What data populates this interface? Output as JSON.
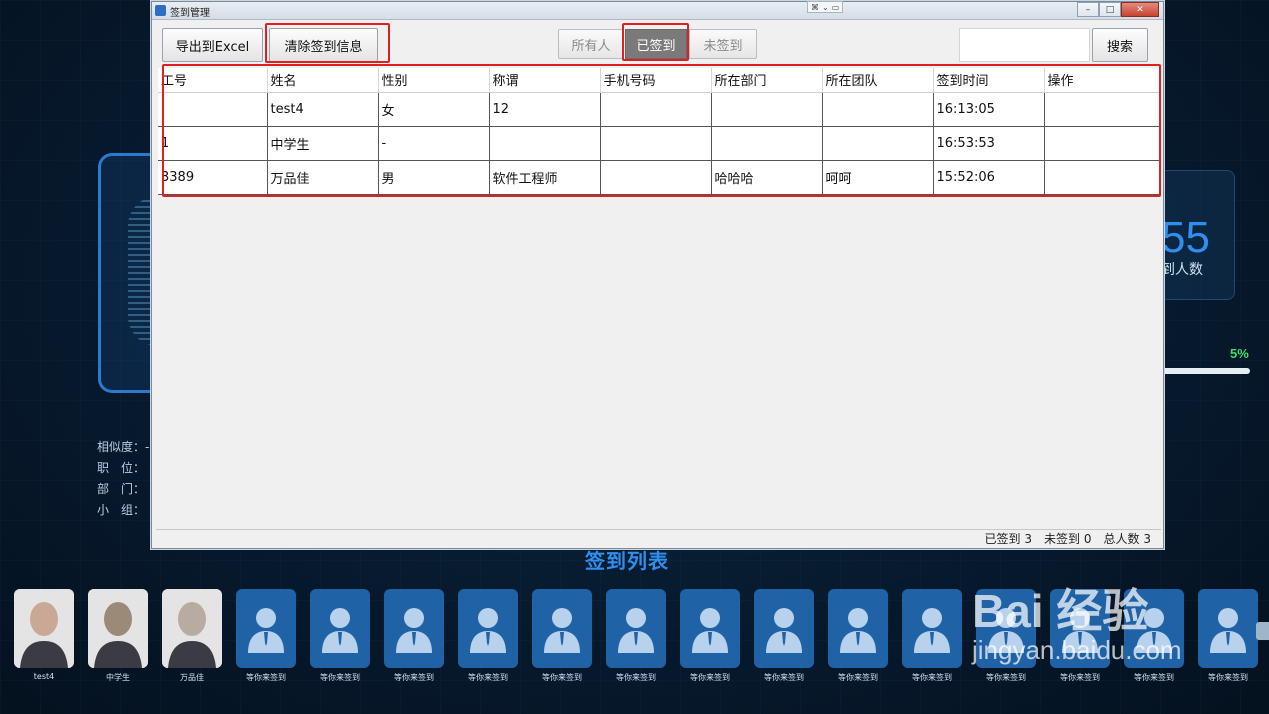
{
  "background": {
    "stat": {
      "value": "55",
      "label": "到人数"
    },
    "progress": {
      "percent_label": "5%",
      "fraction": 0.05
    },
    "info_fields": [
      {
        "label": "相似度：",
        "value": "-"
      },
      {
        "label": "职　位：",
        "value": ""
      },
      {
        "label": "部　门：",
        "value": ""
      },
      {
        "label": "小　组：",
        "value": ""
      }
    ],
    "list_title": "签到列表",
    "avatars": [
      {
        "caption": "test4",
        "type": "photo"
      },
      {
        "caption": "中学生",
        "type": "photo"
      },
      {
        "caption": "万品佳",
        "type": "photo"
      },
      {
        "caption": "等你来签到",
        "type": "placeholder"
      },
      {
        "caption": "等你来签到",
        "type": "placeholder"
      },
      {
        "caption": "等你来签到",
        "type": "placeholder"
      },
      {
        "caption": "等你来签到",
        "type": "placeholder"
      },
      {
        "caption": "等你来签到",
        "type": "placeholder"
      },
      {
        "caption": "等你来签到",
        "type": "placeholder"
      },
      {
        "caption": "等你来签到",
        "type": "placeholder"
      },
      {
        "caption": "等你来签到",
        "type": "placeholder"
      },
      {
        "caption": "等你来签到",
        "type": "placeholder"
      },
      {
        "caption": "等你来签到",
        "type": "placeholder"
      },
      {
        "caption": "等你来签到",
        "type": "placeholder"
      },
      {
        "caption": "等你来签到",
        "type": "placeholder"
      },
      {
        "caption": "等你来签到",
        "type": "placeholder"
      },
      {
        "caption": "等你来签到",
        "type": "placeholder"
      }
    ],
    "watermark": {
      "brand": "Bai 经验",
      "url": "jingyan.baidu.com"
    }
  },
  "window": {
    "title": "签到管理",
    "toolbar": {
      "export_label": "导出到Excel",
      "clear_label": "清除签到信息",
      "filter_all": "所有人",
      "filter_signed": "已签到",
      "filter_unsigned": "未签到",
      "search_value": "",
      "search_label": "搜索"
    },
    "table": {
      "columns": [
        "工号",
        "姓名",
        "性别",
        "称谓",
        "手机号码",
        "所在部门",
        "所在团队",
        "签到时间",
        "操作"
      ],
      "rows": [
        [
          "",
          "test4",
          "女",
          "12",
          "",
          "",
          "",
          "16:13:05",
          ""
        ],
        [
          "1",
          "中学生",
          "-",
          "",
          "",
          "",
          "",
          "16:53:53",
          ""
        ],
        [
          "3389",
          "万品佳",
          "男",
          "软件工程师",
          "",
          "哈哈哈",
          "呵呵",
          "15:52:06",
          ""
        ]
      ]
    },
    "status": {
      "signed_label": "已签到",
      "signed_count": "3",
      "unsigned_label": "未签到",
      "unsigned_count": "0",
      "total_label": "总人数",
      "total_count": "3"
    }
  },
  "colors": {
    "accent_blue": "#2f8ff0",
    "progress_green": "#3ddc6a",
    "highlight_red": "#e02020",
    "avatar_blue": "#1f62a6"
  }
}
